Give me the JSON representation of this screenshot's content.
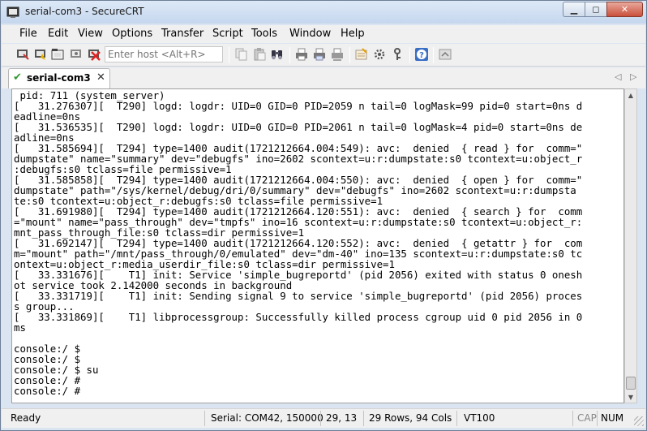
{
  "window": {
    "title": "serial-com3 - SecureCRT",
    "controls": {
      "minimize": "▁",
      "maximize": "◻",
      "close": "✕"
    }
  },
  "menu": [
    "File",
    "Edit",
    "View",
    "Options",
    "Transfer",
    "Script",
    "Tools",
    "Window",
    "Help"
  ],
  "toolbar": {
    "host_placeholder": "Enter host <Alt+R>",
    "icons": [
      "connect-icon",
      "quick-connect-icon",
      "connect-in-tab-icon",
      "reconnect-icon",
      "disconnect-icon",
      "copy-icon",
      "paste-icon",
      "find-icon",
      "print-icon",
      "print-selection-icon",
      "print-setup-icon",
      "session-options-icon",
      "global-options-icon",
      "keymap-icon",
      "help-icon",
      "sftp-icon"
    ]
  },
  "tab": {
    "label": "serial-com3",
    "close": "✕",
    "nav_left": "◁",
    "nav_right": "▷"
  },
  "terminal": {
    "lines": [
      " pid: 711 (system_server)",
      "[   31.276307][  T290] logd: logdr: UID=0 GID=0 PID=2059 n tail=0 logMask=99 pid=0 start=0ns d",
      "eadline=0ns",
      "[   31.536535][  T290] logd: logdr: UID=0 GID=0 PID=2061 n tail=0 logMask=4 pid=0 start=0ns de",
      "adline=0ns",
      "[   31.585694][  T294] type=1400 audit(1721212664.004:549): avc:  denied  { read } for  comm=\"",
      "dumpstate\" name=\"summary\" dev=\"debugfs\" ino=2602 scontext=u:r:dumpstate:s0 tcontext=u:object_r",
      ":debugfs:s0 tclass=file permissive=1",
      "[   31.585858][  T294] type=1400 audit(1721212664.004:550): avc:  denied  { open } for  comm=\"",
      "dumpstate\" path=\"/sys/kernel/debug/dri/0/summary\" dev=\"debugfs\" ino=2602 scontext=u:r:dumpsta",
      "te:s0 tcontext=u:object_r:debugfs:s0 tclass=file permissive=1",
      "[   31.691980][  T294] type=1400 audit(1721212664.120:551): avc:  denied  { search } for  comm",
      "=\"mount\" name=\"pass_through\" dev=\"tmpfs\" ino=16 scontext=u:r:dumpstate:s0 tcontext=u:object_r:",
      "mnt_pass_through_file:s0 tclass=dir permissive=1",
      "[   31.692147][  T294] type=1400 audit(1721212664.120:552): avc:  denied  { getattr } for  com",
      "m=\"mount\" path=\"/mnt/pass_through/0/emulated\" dev=\"dm-40\" ino=135 scontext=u:r:dumpstate:s0 tc",
      "ontext=u:object_r:media_userdir_file:s0 tclass=dir permissive=1",
      "[   33.331676][    T1] init: Service 'simple_bugreportd' (pid 2056) exited with status 0 onesh",
      "ot service took 2.142000 seconds in background",
      "[   33.331719][    T1] init: Sending signal 9 to service 'simple_bugreportd' (pid 2056) proces",
      "s group...",
      "[   33.331869][    T1] libprocessgroup: Successfully killed process cgroup uid 0 pid 2056 in 0",
      "ms",
      "",
      "console:/ $",
      "console:/ $",
      "console:/ $ su",
      "console:/ #",
      "console:/ #"
    ]
  },
  "status": {
    "ready": "Ready",
    "connection": "Serial: COM42, 150000",
    "cursor": "29,  13",
    "size": "29 Rows, 94 Cols",
    "emulation": "VT100",
    "caps": "CAP",
    "num": "NUM"
  }
}
